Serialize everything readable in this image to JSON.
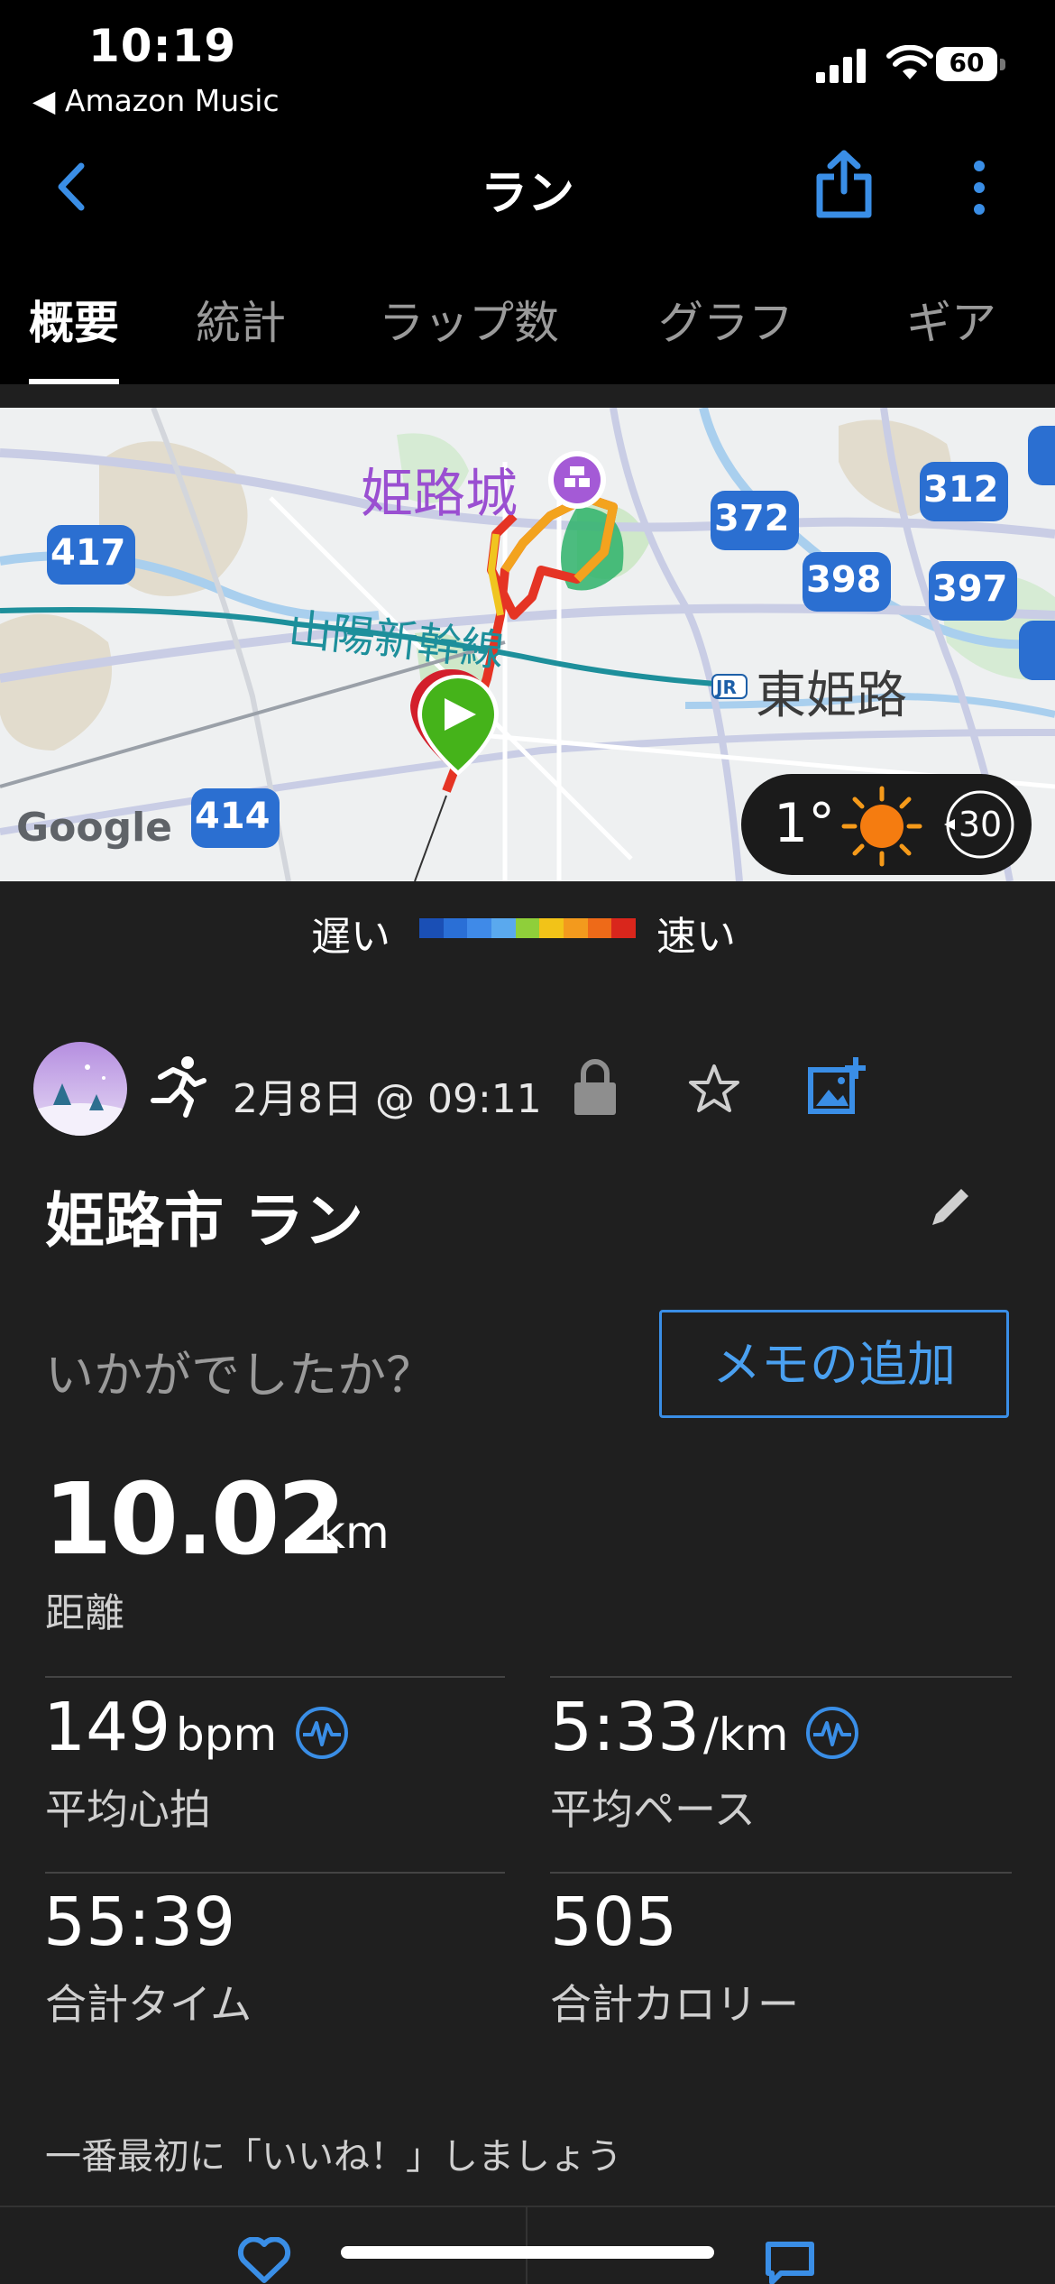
{
  "status_bar": {
    "time": "10:19",
    "back_app": "◀ Amazon Music",
    "battery": "60"
  },
  "nav": {
    "title": "ラン"
  },
  "tabs": [
    "概要",
    "統計",
    "ラップ数",
    "グラフ",
    "ギア"
  ],
  "map": {
    "castle_label": "姫路城",
    "station_label": "東姫路",
    "jr_label": "JR",
    "railway_label": "山陽新幹線",
    "routes": [
      "417",
      "372",
      "312",
      "398",
      "397",
      "414"
    ],
    "attribution": "Google",
    "weather": {
      "temperature": "1°",
      "wind": "30"
    }
  },
  "legend": {
    "slow": "遅い",
    "fast": "速い",
    "colors": [
      "#1a4fb5",
      "#2a6fd6",
      "#3f8ae8",
      "#5aa9ee",
      "#8fcf3a",
      "#f2c318",
      "#f39a1d",
      "#ee6a18",
      "#d9261c"
    ]
  },
  "activity": {
    "datetime": "2月8日 @ 09:11",
    "title": "姫路市 ラン",
    "prompt": "いかがでしたか？",
    "memo_button": "メモの追加",
    "distance": {
      "value": "10.02",
      "unit": "km",
      "label": "距離"
    },
    "heart_rate": {
      "value": "149",
      "unit": "bpm",
      "label": "平均心拍"
    },
    "pace": {
      "value": "5:33",
      "unit": "/km",
      "label": "平均ペース"
    },
    "total_time": {
      "value": "55:39",
      "label": "合計タイム"
    },
    "calories": {
      "value": "505",
      "label": "合計カロリー"
    },
    "like_prompt": "一番最初に「いいね！」しましょう"
  },
  "accent_color": "#3a8ee6"
}
